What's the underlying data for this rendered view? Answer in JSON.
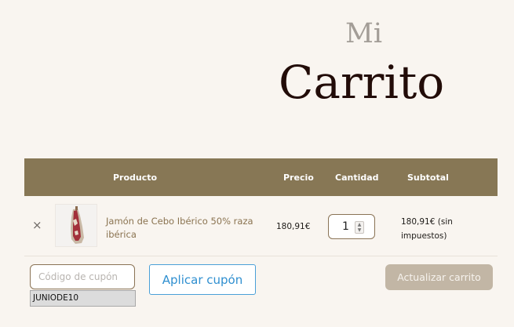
{
  "page": {
    "title_small": "Mi",
    "title_big": "Carrito"
  },
  "table": {
    "headers": [
      "Producto",
      "Precio",
      "Cantidad",
      "Subtotal"
    ]
  },
  "cart_items": [
    {
      "remove_label": "×",
      "name": "Jamón de Cebo Ibérico 50% raza ibérica",
      "price": "180,91€",
      "quantity": "1",
      "subtotal": "180,91€ (sin impuestos)"
    }
  ],
  "coupon": {
    "placeholder": "Código de cupón",
    "value": "",
    "autocomplete_suggestion": "JUNIODE10",
    "apply_label": "Aplicar cupón"
  },
  "actions": {
    "update_label": "Actualizar carrito"
  },
  "colors": {
    "background": "#f9f5f0",
    "header_bg": "#877755",
    "accent_blue": "#2f8fd0",
    "update_btn_bg": "#c2b6a5"
  }
}
